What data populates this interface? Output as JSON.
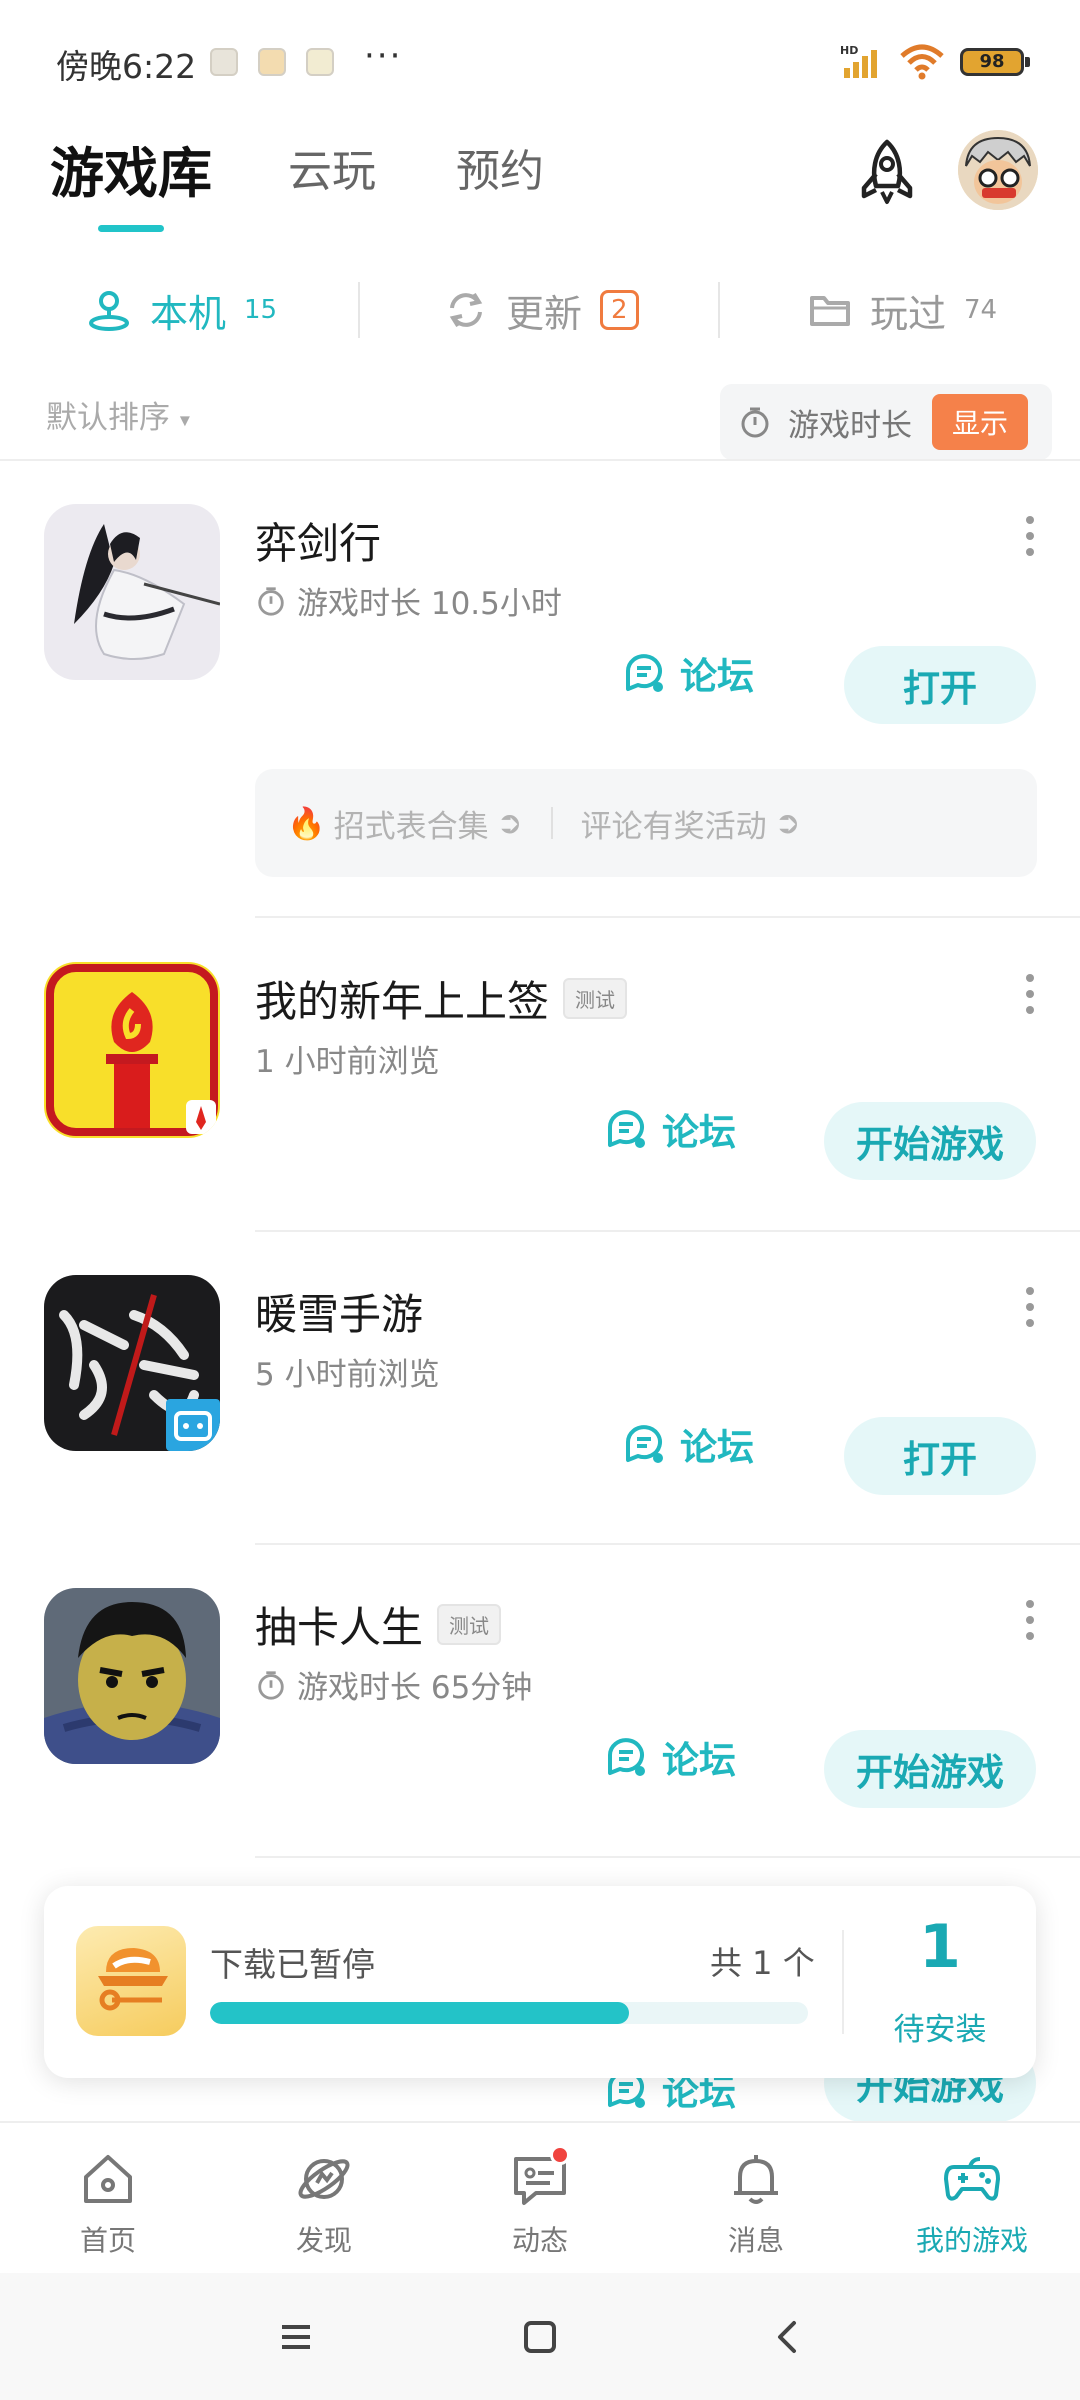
{
  "status_bar": {
    "time": "傍晚6:22",
    "more": "···",
    "battery": "98",
    "signal_label": "HD"
  },
  "header": {
    "tabs": [
      {
        "label": "游戏库",
        "active": true
      },
      {
        "label": "云玩",
        "active": false
      },
      {
        "label": "预约",
        "active": false
      }
    ],
    "rocket_icon": "rocket-icon",
    "avatar": "user-avatar"
  },
  "sub_tabs": {
    "local": {
      "label": "本机",
      "count": "15"
    },
    "update": {
      "label": "更新",
      "count": "2"
    },
    "played": {
      "label": "玩过",
      "count": "74"
    }
  },
  "sort": {
    "label": "默认排序",
    "playtime_label": "游戏时长",
    "show_button": "显示"
  },
  "games": [
    {
      "title": "弈剑行",
      "badge": "",
      "sub": "游戏时长 10.5小时",
      "forum": "论坛",
      "action": "打开",
      "extras": [
        "招式表合集",
        "评论有奖活动"
      ]
    },
    {
      "title": "我的新年上上签",
      "badge": "测试",
      "sub": "1 小时前浏览",
      "forum": "论坛",
      "action": "开始游戏"
    },
    {
      "title": "暖雪手游",
      "badge": "",
      "sub": "5 小时前浏览",
      "forum": "论坛",
      "action": "打开"
    },
    {
      "title": "抽卡人生",
      "badge": "测试",
      "sub": "游戏时长 65分钟",
      "forum": "论坛",
      "action": "开始游戏"
    },
    {
      "title": "",
      "forum": "论坛",
      "action": "开始游戏"
    }
  ],
  "download": {
    "status": "下载已暂停",
    "total": "共 1 个",
    "progress": 0.7,
    "pending_count": "1",
    "pending_label": "待安装"
  },
  "bottom_nav": [
    {
      "label": "首页",
      "icon": "home-icon"
    },
    {
      "label": "发现",
      "icon": "discover-icon"
    },
    {
      "label": "动态",
      "icon": "feed-icon",
      "dot": true
    },
    {
      "label": "消息",
      "icon": "bell-icon"
    },
    {
      "label": "我的游戏",
      "icon": "gamepad-icon",
      "active": true
    }
  ],
  "colors": {
    "accent": "#21c4c9",
    "accent_text": "#1aa9b3",
    "orange": "#f5814a",
    "badge_red": "#f0443f"
  }
}
